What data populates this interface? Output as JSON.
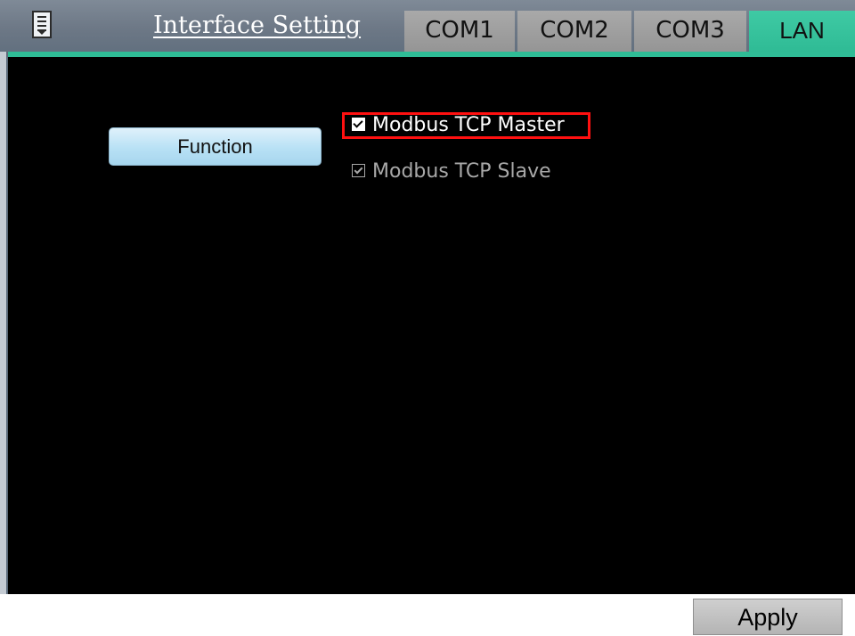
{
  "header": {
    "title": "Interface Setting",
    "menu_icon": "menu-list-icon",
    "tabs": [
      {
        "label": "COM1",
        "active": false
      },
      {
        "label": "COM2",
        "active": false
      },
      {
        "label": "COM3",
        "active": false
      },
      {
        "label": "LAN",
        "active": true
      }
    ]
  },
  "main": {
    "function_label": "Function",
    "options": [
      {
        "label": "Modbus TCP Master",
        "checked": true,
        "enabled": true,
        "highlighted": true
      },
      {
        "label": "Modbus TCP Slave",
        "checked": true,
        "enabled": false,
        "highlighted": false
      }
    ]
  },
  "footer": {
    "apply_label": "Apply"
  },
  "colors": {
    "header_bg": "#6d7886",
    "accent": "#2fbc96",
    "inactive_tab": "#a0a0a0",
    "content_bg": "#000000",
    "highlight_border": "#ff1010",
    "function_button": "#b8e1f5",
    "disabled_text": "#a8a8a8"
  }
}
